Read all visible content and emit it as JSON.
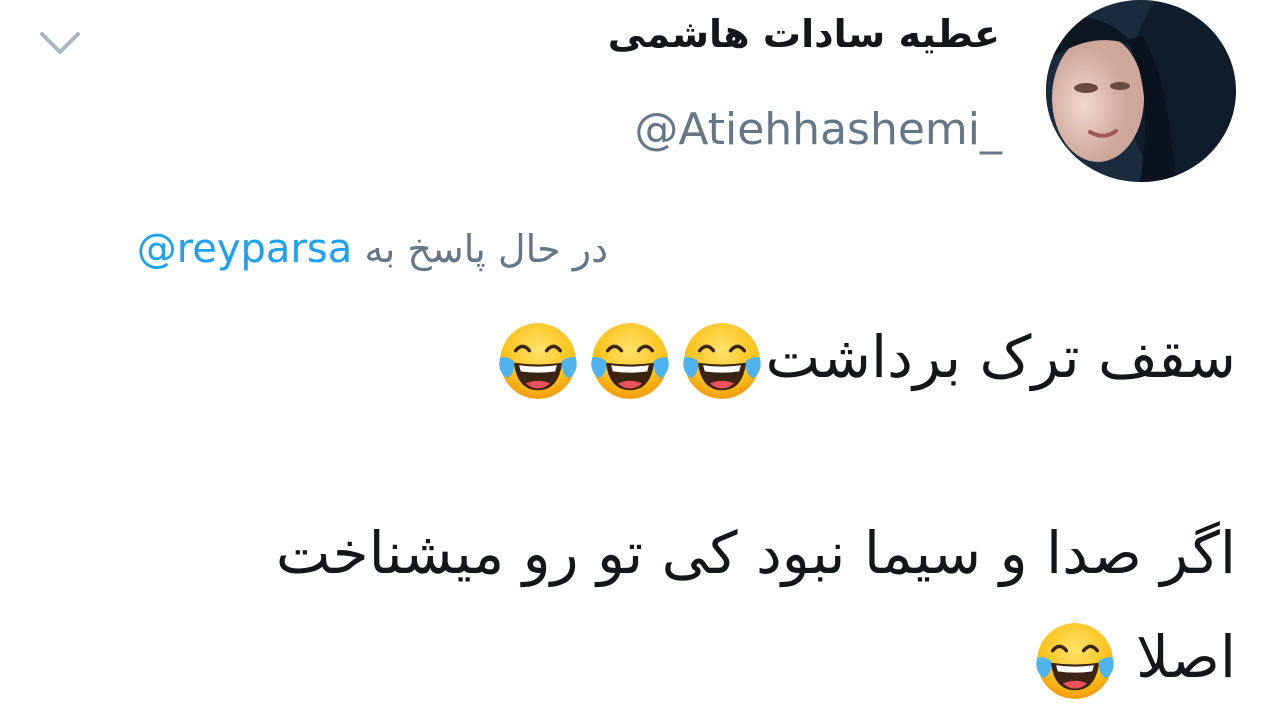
{
  "header": {
    "display_name": "عطیه سادات هاشمی",
    "handle": "@Atiehhashemi_",
    "menu_icon": "chevron-down-icon",
    "avatar_icon": "avatar"
  },
  "reply": {
    "prefix": "در حال پاسخ به",
    "mention": "@reyparsa"
  },
  "tweet": {
    "line1": "سقف ترک برداشت",
    "line1_emoji": "face-with-tears-of-joy",
    "line1_emoji_count": 3,
    "line2": "اگر صدا و سیما نبود کی تو رو میشناخت",
    "line3": "اصلا",
    "line3_emoji": "face-with-tears-of-joy"
  },
  "colors": {
    "text": "#14171a",
    "secondary": "#657786",
    "link": "#1da1f2",
    "chevron": "#aab8c2"
  }
}
